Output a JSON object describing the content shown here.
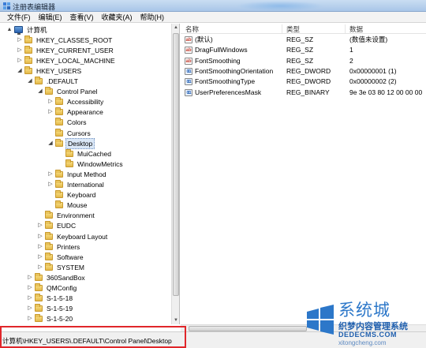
{
  "window": {
    "title": "注册表编辑器"
  },
  "menu": [
    "文件(F)",
    "编辑(E)",
    "查看(V)",
    "收藏夹(A)",
    "帮助(H)"
  ],
  "tree": [
    {
      "label": "计算机",
      "icon": "computer-icon",
      "toggle": "▲",
      "level": 0
    },
    {
      "label": "HKEY_CLASSES_ROOT",
      "toggle": "▷",
      "level": 1
    },
    {
      "label": "HKEY_CURRENT_USER",
      "toggle": "▷",
      "level": 1
    },
    {
      "label": "HKEY_LOCAL_MACHINE",
      "toggle": "▷",
      "level": 1
    },
    {
      "label": "HKEY_USERS",
      "toggle": "◢",
      "level": 1
    },
    {
      "label": ".DEFAULT",
      "toggle": "◢",
      "level": 2
    },
    {
      "label": "Control Panel",
      "toggle": "◢",
      "level": 3
    },
    {
      "label": "Accessibility",
      "toggle": "▷",
      "level": 4
    },
    {
      "label": "Appearance",
      "toggle": "▷",
      "level": 4
    },
    {
      "label": "Colors",
      "toggle": "",
      "level": 4
    },
    {
      "label": "Cursors",
      "toggle": "",
      "level": 4
    },
    {
      "label": "Desktop",
      "toggle": "◢",
      "level": 4,
      "selected": true
    },
    {
      "label": "MuiCached",
      "toggle": "",
      "level": 5
    },
    {
      "label": "WindowMetrics",
      "toggle": "",
      "level": 5
    },
    {
      "label": "Input Method",
      "toggle": "▷",
      "level": 4
    },
    {
      "label": "International",
      "toggle": "▷",
      "level": 4
    },
    {
      "label": "Keyboard",
      "toggle": "",
      "level": 4
    },
    {
      "label": "Mouse",
      "toggle": "",
      "level": 4
    },
    {
      "label": "Environment",
      "toggle": "",
      "level": 3
    },
    {
      "label": "EUDC",
      "toggle": "▷",
      "level": 3
    },
    {
      "label": "Keyboard Layout",
      "toggle": "▷",
      "level": 3
    },
    {
      "label": "Printers",
      "toggle": "▷",
      "level": 3
    },
    {
      "label": "Software",
      "toggle": "▷",
      "level": 3
    },
    {
      "label": "SYSTEM",
      "toggle": "▷",
      "level": 3
    },
    {
      "label": "360SandBox",
      "toggle": "▷",
      "level": 2
    },
    {
      "label": "QMConfig",
      "toggle": "▷",
      "level": 2
    },
    {
      "label": "S-1-5-18",
      "toggle": "▷",
      "level": 2
    },
    {
      "label": "S-1-5-19",
      "toggle": "▷",
      "level": 2
    },
    {
      "label": "S-1-5-20",
      "toggle": "▷",
      "level": 2
    }
  ],
  "list": {
    "headers": {
      "name": "名称",
      "type": "类型",
      "data": "数据"
    },
    "rows": [
      {
        "icon": "ab",
        "name": "(默认)",
        "type": "REG_SZ",
        "data": "(数值未设置)"
      },
      {
        "icon": "ab",
        "name": "DragFullWindows",
        "type": "REG_SZ",
        "data": "1"
      },
      {
        "icon": "ab",
        "name": "FontSmoothing",
        "type": "REG_SZ",
        "data": "2"
      },
      {
        "icon": "bin",
        "name": "FontSmoothingOrientation",
        "type": "REG_DWORD",
        "data": "0x00000001 (1)"
      },
      {
        "icon": "bin",
        "name": "FontSmoothingType",
        "type": "REG_DWORD",
        "data": "0x00000002 (2)"
      },
      {
        "icon": "bin",
        "name": "UserPreferencesMask",
        "type": "REG_BINARY",
        "data": "9e 3e 03 80 12 00 00 00"
      }
    ]
  },
  "status": {
    "path": "计算机\\HKEY_USERS\\.DEFAULT\\Control Panel\\Desktop"
  },
  "watermark": {
    "big": "系统城",
    "line1": "织梦内容管理系统",
    "line2": "DEDECMS.COM",
    "line3": "xitongcheng.com"
  },
  "colors": {
    "highlight": "#e0262a",
    "selection": "#dbe8f7",
    "watermark": "#2c77c9"
  }
}
